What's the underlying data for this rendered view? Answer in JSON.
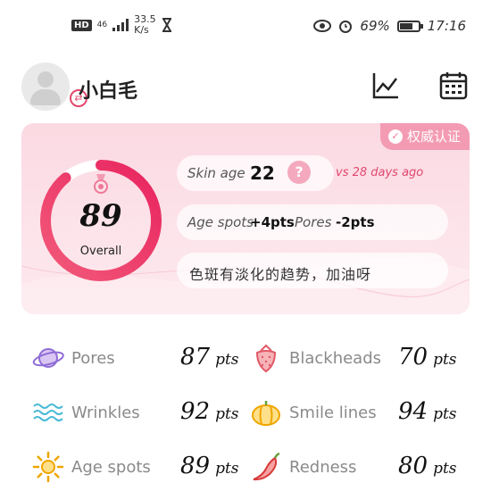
{
  "status_bar": {
    "hd": "HD",
    "network": "46",
    "speed_value": "33.5",
    "speed_unit": "K/s",
    "battery_percent": "69%",
    "battery_level": 0.69,
    "time": "17:16"
  },
  "header": {
    "username": "小白毛",
    "icons": [
      "trend-chart-icon",
      "calendar-icon"
    ]
  },
  "summary": {
    "badge": "权威认证",
    "score": "89",
    "score_label": "Overall",
    "ring_fraction": 0.89,
    "skin_age_label": "Skin age",
    "skin_age_value": "22",
    "question_mark": "?",
    "vs_text": "vs 28 days ago",
    "age_spots_label": "Age spots",
    "age_spots_delta": "+4pts",
    "pores_label": "Pores",
    "pores_delta": "-2pts",
    "message": "色斑有淡化的趋势，加油呀"
  },
  "metrics": [
    {
      "label": "Pores",
      "value": "87",
      "unit": "pts",
      "icon": "planet-icon"
    },
    {
      "label": "Blackheads",
      "value": "70",
      "unit": "pts",
      "icon": "strawberry-icon"
    },
    {
      "label": "Wrinkles",
      "value": "92",
      "unit": "pts",
      "icon": "waves-icon"
    },
    {
      "label": "Smile lines",
      "value": "94",
      "unit": "pts",
      "icon": "pumpkin-icon"
    },
    {
      "label": "Age spots",
      "value": "89",
      "unit": "pts",
      "icon": "sun-icon"
    },
    {
      "label": "Redness",
      "value": "80",
      "unit": "pts",
      "icon": "chili-icon"
    }
  ],
  "colors": {
    "accent": "#e2476e",
    "card_bg": "#fbd9e2",
    "badge_bg": "#f39bb3"
  }
}
